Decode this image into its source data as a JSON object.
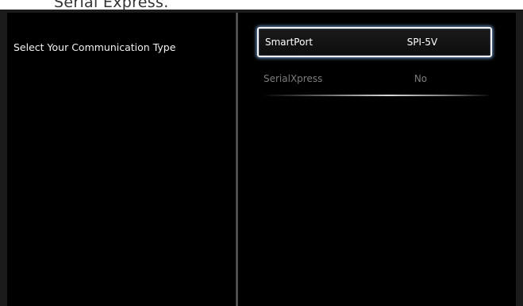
{
  "caption": "Serial Express.",
  "left_panel": {
    "title": "Select Your Communication Type"
  },
  "options": [
    {
      "label": "SmartPort",
      "value": "SPI-5V",
      "selected": true
    },
    {
      "label": "SerialXpress",
      "value": "No",
      "selected": false
    }
  ],
  "colors": {
    "panel_background": "#000000",
    "selected_border": "#f4f4f4",
    "selected_glow": "#8cbeff",
    "inactive_text": "#7d7d7d"
  }
}
